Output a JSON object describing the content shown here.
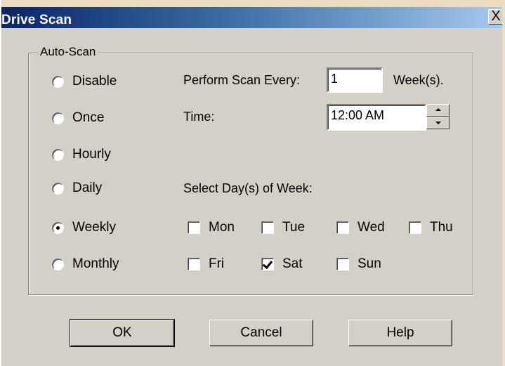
{
  "window": {
    "title": "Drive Scan",
    "close_glyph": "X"
  },
  "auto_scan": {
    "group_label": "Auto-Scan",
    "options": [
      {
        "label": "Disable",
        "checked": false
      },
      {
        "label": "Once",
        "checked": false
      },
      {
        "label": "Hourly",
        "checked": false
      },
      {
        "label": "Daily",
        "checked": false
      },
      {
        "label": "Weekly",
        "checked": true
      },
      {
        "label": "Monthly",
        "checked": false
      }
    ]
  },
  "schedule": {
    "every_label": "Perform Scan Every:",
    "every_value": "1",
    "every_unit": "Week(s).",
    "time_label": "Time:",
    "time_value": "12:00 AM",
    "days_label": "Select Day(s) of Week:",
    "days": [
      {
        "label": "Mon",
        "checked": false
      },
      {
        "label": "Tue",
        "checked": false
      },
      {
        "label": "Wed",
        "checked": false
      },
      {
        "label": "Thu",
        "checked": false
      },
      {
        "label": "Fri",
        "checked": false
      },
      {
        "label": "Sat",
        "checked": true
      },
      {
        "label": "Sun",
        "checked": false
      }
    ]
  },
  "buttons": {
    "ok": "OK",
    "cancel": "Cancel",
    "help": "Help"
  },
  "colors": {
    "title_gradient_start": "#0a246a",
    "title_gradient_end": "#a6caf0",
    "dialog_face": "#d4d0c8"
  }
}
